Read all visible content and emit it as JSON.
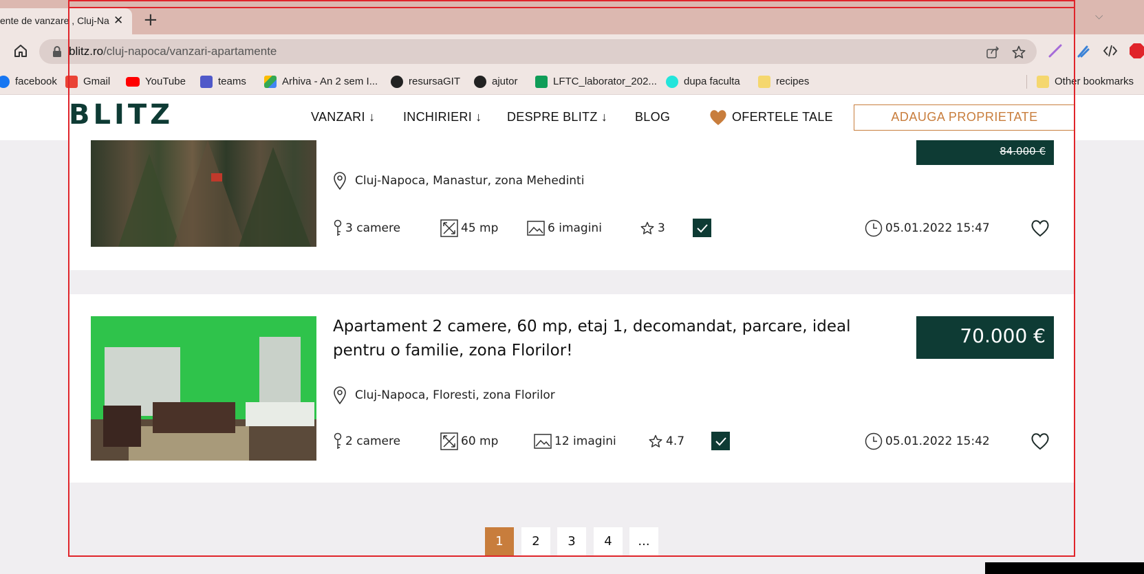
{
  "browser": {
    "tab_title": "ente de vanzare , Cluj-Na",
    "tab_close": "✕",
    "new_tab": "+",
    "tab_menu": "⌵",
    "url_domain": "blitz.ro",
    "url_path": "/cluj-napoca/vanzari-apartamente",
    "bookmarks": [
      {
        "label": "facebook",
        "icon": "facebook-icon",
        "color": "#1877f2"
      },
      {
        "label": "Gmail",
        "icon": "gmail-icon",
        "color": "#ea4335"
      },
      {
        "label": "YouTube",
        "icon": "youtube-icon",
        "color": "#ff0000"
      },
      {
        "label": "teams",
        "icon": "teams-icon",
        "color": "#5059c9"
      },
      {
        "label": "Arhiva - An 2 sem I...",
        "icon": "google-drive-icon",
        "color": "#34a853"
      },
      {
        "label": "resursaGIT",
        "icon": "github-icon",
        "color": "#222222"
      },
      {
        "label": "ajutor",
        "icon": "github-icon",
        "color": "#222222"
      },
      {
        "label": "LFTC_laborator_202...",
        "icon": "sheets-icon",
        "color": "#0f9d58"
      },
      {
        "label": "dupa faculta",
        "icon": "olx-icon",
        "color": "#23e5db"
      },
      {
        "label": "recipes",
        "icon": "folder-icon",
        "color": "#f5d76e"
      }
    ],
    "other_bookmarks": "Other bookmarks"
  },
  "site": {
    "logo": "BLITZ",
    "nav": {
      "sales": "VANZARI ↓",
      "rentals": "INCHIRIERI ↓",
      "about": "DESPRE BLITZ ↓",
      "blog": "BLOG",
      "offers": "OFERTELE TALE"
    },
    "add_property": "ADAUGA PROPRIETATE",
    "accent_color": "#c87d3c",
    "brand_color": "#0e3b34"
  },
  "listings": [
    {
      "price": "84.000 €",
      "price_struck": true,
      "location": "Cluj-Napoca, Manastur, zona Mehedinti",
      "rooms": "3 camere",
      "area": "45 mp",
      "images": "6 imagini",
      "rating": "3",
      "date": "05.01.2022 15:47"
    },
    {
      "title": "Apartament 2 camere, 60 mp, etaj 1, decomandat, parcare, ideal pentru o familie, zona Florilor!",
      "price": "70.000 €",
      "price_struck": false,
      "location": "Cluj-Napoca, Floresti, zona Florilor",
      "rooms": "2 camere",
      "area": "60 mp",
      "images": "12 imagini",
      "rating": "4.7",
      "date": "05.01.2022 15:42"
    }
  ],
  "pagination": [
    "1",
    "2",
    "3",
    "4",
    "..."
  ],
  "current_page": "1"
}
